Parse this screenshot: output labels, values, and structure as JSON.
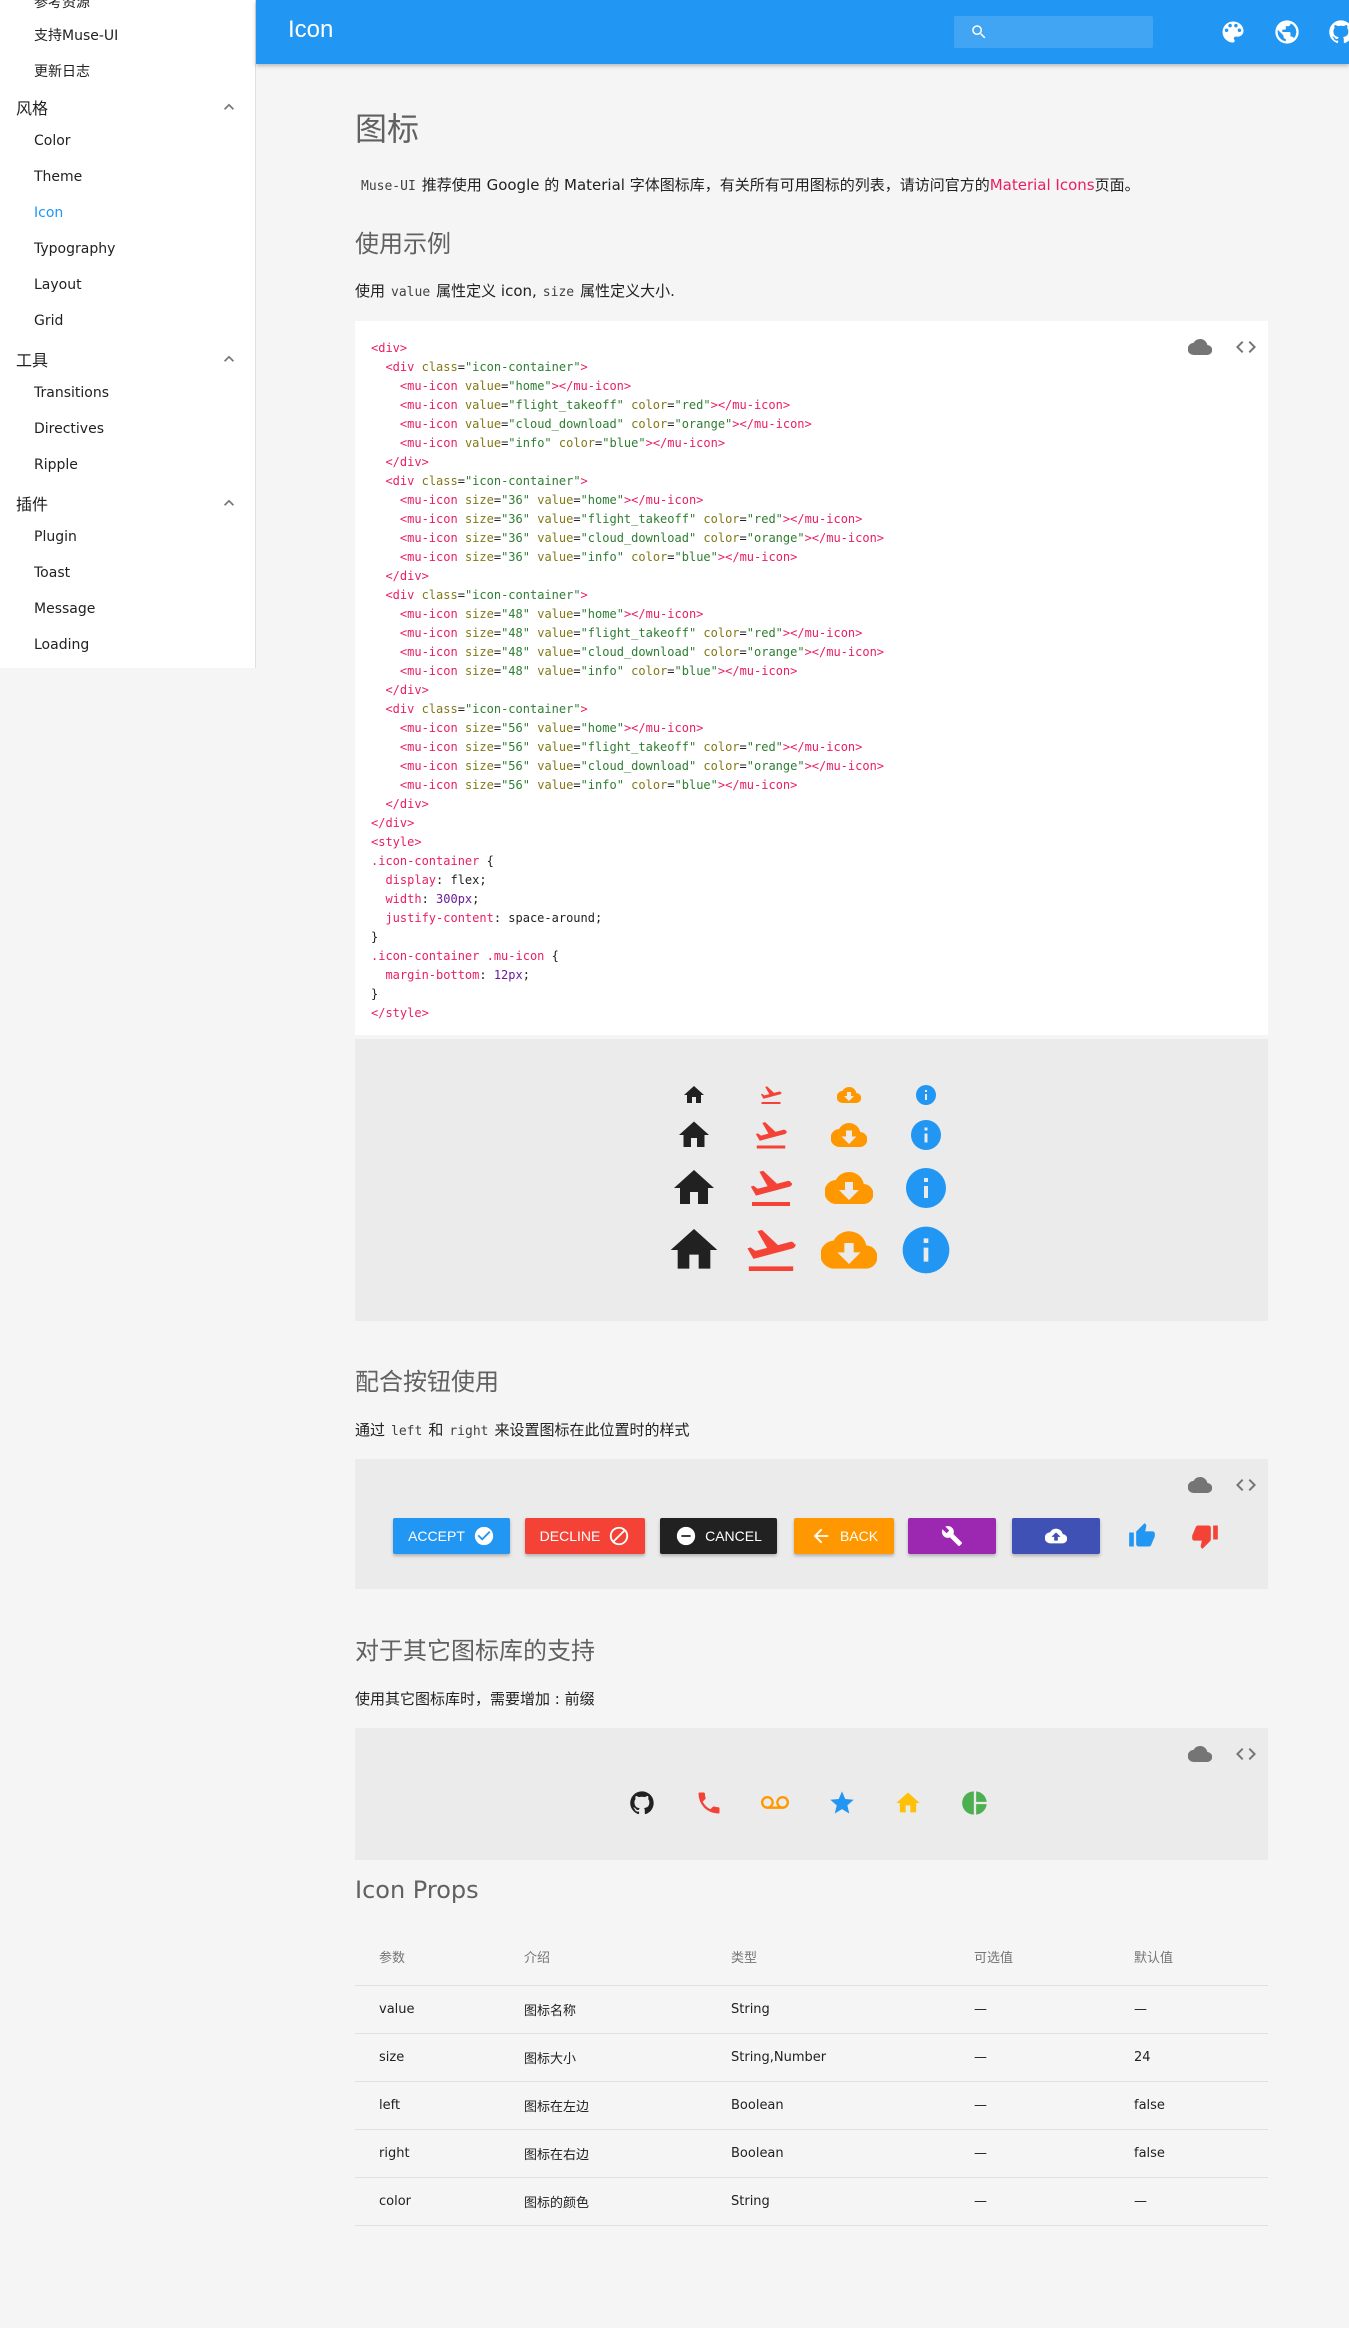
{
  "sidebar": {
    "top_items": [
      {
        "label": "参考资源",
        "y": -8
      },
      {
        "label": "支持Muse-UI",
        "y": 25
      },
      {
        "label": "更新日志",
        "y": 61
      }
    ],
    "groups": [
      {
        "title": "风格",
        "items": [
          "Color",
          "Theme",
          "Icon",
          "Typography",
          "Layout",
          "Grid"
        ]
      },
      {
        "title": "工具",
        "items": [
          "Transitions",
          "Directives",
          "Ripple"
        ]
      },
      {
        "title": "插件",
        "items": [
          "Plugin",
          "Toast",
          "Message",
          "Loading"
        ]
      }
    ],
    "active_item": "Icon"
  },
  "appbar": {
    "title": "Icon",
    "search_placeholder": "",
    "icons": [
      "palette-icon",
      "language-icon",
      "github-icon"
    ],
    "color": "#2196f3"
  },
  "page": {
    "title": "图标",
    "intro_code": "Muse-UI",
    "intro_text": "推荐使用 Google 的 Material 字体图标库，有关所有可用图标的列表，请访问官方的",
    "intro_link": "Material Icons",
    "intro_suffix": "页面。",
    "example_title": "使用示例",
    "example_pre": "使用",
    "example_code1": "value",
    "example_mid": "属性定义 icon,",
    "example_code2": "size",
    "example_post": "属性定义大小.",
    "button_title": "配合按钮使用",
    "button_pre": "通过",
    "button_code1": "left",
    "button_mid": "和",
    "button_code2": "right",
    "button_post": "来设置图标在此位置时的样式",
    "other_title": "对于其它图标库的支持",
    "other_text": "使用其它图标库时，需要增加 : 前缀",
    "props_title": "Icon Props"
  },
  "buttons": [
    {
      "label": "ACCEPT",
      "icon": "check-circle-icon",
      "color": "#2196f3"
    },
    {
      "label": "DECLINE",
      "icon": "block-icon",
      "color": "#f44336"
    },
    {
      "label": "CANCEL",
      "icon": "remove-circle-icon",
      "color": "#212121"
    },
    {
      "label": "BACK",
      "icon": "arrow-back-icon",
      "color": "#ff9800"
    },
    {
      "label": "",
      "icon": "build-icon",
      "color": "#9c27b0"
    },
    {
      "label": "",
      "icon": "cloud-upload-icon",
      "color": "#3f51b5"
    }
  ],
  "flat_icons": [
    {
      "icon": "thumb-up-icon",
      "color": "#2196f3"
    },
    {
      "icon": "thumb-down-icon",
      "color": "#f44336"
    }
  ],
  "other_icons": [
    {
      "icon": "github-icon",
      "color": "#212121"
    },
    {
      "icon": "phone-icon",
      "color": "#f44336"
    },
    {
      "icon": "voicemail-icon",
      "color": "#ff9800"
    },
    {
      "icon": "star-icon",
      "color": "#2196f3"
    },
    {
      "icon": "home-icon",
      "color": "#ffc107"
    },
    {
      "icon": "pie-chart-icon",
      "color": "#4caf50"
    }
  ],
  "demo_colors": {
    "home": "#212121",
    "flight_takeoff": "#f44336",
    "cloud_download": "#ff9800",
    "info": "#2196f3"
  },
  "demo_sizes": [
    24,
    36,
    48,
    56
  ],
  "props_table": {
    "headers": [
      "参数",
      "介绍",
      "类型",
      "可选值",
      "默认值"
    ],
    "rows": [
      [
        "value",
        "图标名称",
        "String",
        "—",
        "—"
      ],
      [
        "size",
        "图标大小",
        "String,Number",
        "—",
        "24"
      ],
      [
        "left",
        "图标在左边",
        "Boolean",
        "—",
        "false"
      ],
      [
        "right",
        "图标在右边",
        "Boolean",
        "—",
        "false"
      ],
      [
        "color",
        "图标的颜色",
        "String",
        "—",
        "—"
      ]
    ]
  }
}
